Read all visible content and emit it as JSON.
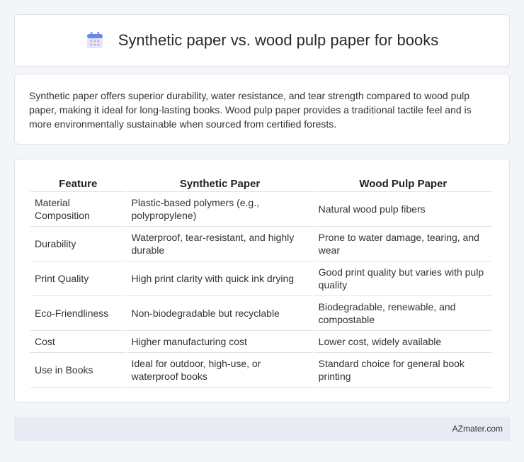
{
  "header": {
    "title": "Synthetic paper vs. wood pulp paper for books",
    "icon": "calendar-icon"
  },
  "summary": {
    "text": "Synthetic paper offers superior durability, water resistance, and tear strength compared to wood pulp paper, making it ideal for long-lasting books. Wood pulp paper provides a traditional tactile feel and is more environmentally sustainable when sourced from certified forests."
  },
  "table": {
    "headers": [
      "Feature",
      "Synthetic Paper",
      "Wood Pulp Paper"
    ],
    "rows": [
      [
        "Material Composition",
        "Plastic-based polymers (e.g., polypropylene)",
        "Natural wood pulp fibers"
      ],
      [
        "Durability",
        "Waterproof, tear-resistant, and highly durable",
        "Prone to water damage, tearing, and wear"
      ],
      [
        "Print Quality",
        "High print clarity with quick ink drying",
        "Good print quality but varies with pulp quality"
      ],
      [
        "Eco-Friendliness",
        "Non-biodegradable but recyclable",
        "Biodegradable, renewable, and compostable"
      ],
      [
        "Cost",
        "Higher manufacturing cost",
        "Lower cost, widely available"
      ],
      [
        "Use in Books",
        "Ideal for outdoor, high-use, or waterproof books",
        "Standard choice for general book printing"
      ]
    ]
  },
  "footer": {
    "brand": "AZmater.com"
  }
}
